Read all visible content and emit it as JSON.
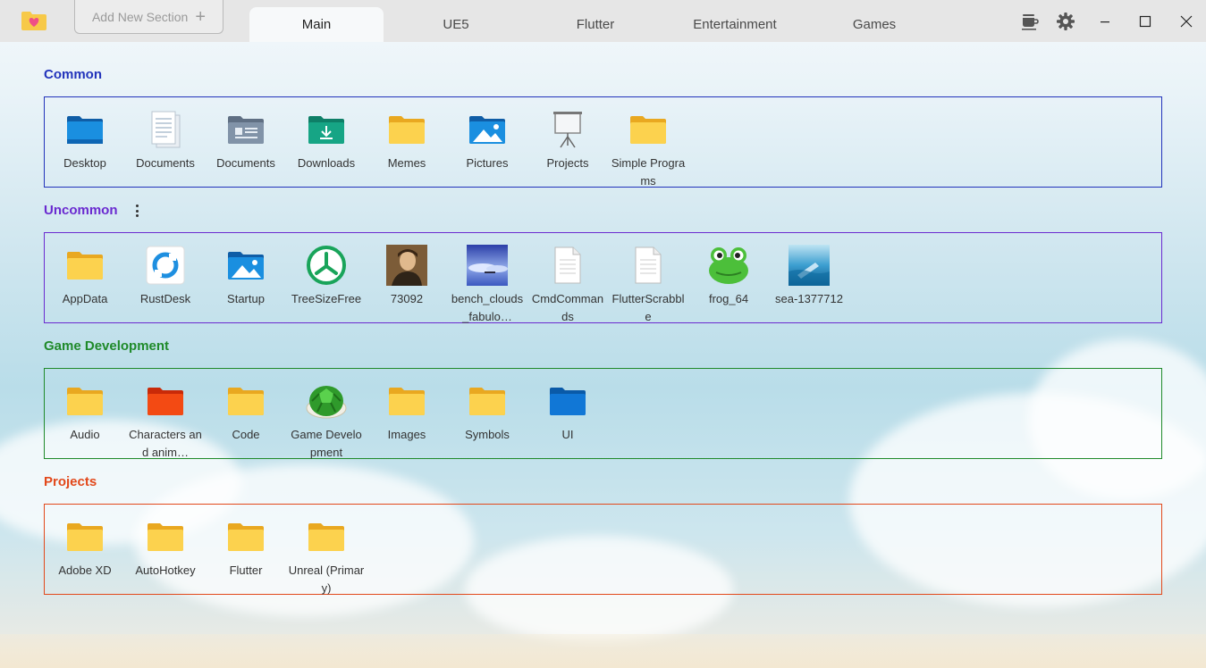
{
  "titlebar": {
    "add_section_label": "Add New Section",
    "tabs": [
      {
        "label": "Main",
        "active": true
      },
      {
        "label": "UE5",
        "active": false
      },
      {
        "label": "Flutter",
        "active": false
      },
      {
        "label": "Entertainment",
        "active": false
      },
      {
        "label": "Games",
        "active": false
      }
    ],
    "icons": [
      "coffee-icon",
      "gear-icon",
      "minimize-icon",
      "maximize-icon",
      "close-icon"
    ]
  },
  "sections": [
    {
      "title": "Common",
      "color": "#2233bb",
      "items": [
        {
          "label": "Desktop",
          "icon": "desktop-folder-icon"
        },
        {
          "label": "Documents",
          "icon": "document-file-icon"
        },
        {
          "label": "Documents",
          "icon": "documents-folder-icon"
        },
        {
          "label": "Downloads",
          "icon": "downloads-folder-icon"
        },
        {
          "label": "Memes",
          "icon": "folder-icon"
        },
        {
          "label": "Pictures",
          "icon": "pictures-folder-icon"
        },
        {
          "label": "Projects",
          "icon": "projector-icon"
        },
        {
          "label": "Simple Programs",
          "icon": "folder-icon"
        }
      ]
    },
    {
      "title": "Uncommon",
      "color": "#6a2ad0",
      "items": [
        {
          "label": "AppData",
          "icon": "folder-icon"
        },
        {
          "label": "RustDesk",
          "icon": "rustdesk-icon"
        },
        {
          "label": "Startup",
          "icon": "pictures-folder-icon"
        },
        {
          "label": "TreeSizeFree",
          "icon": "treesize-icon"
        },
        {
          "label": "73092",
          "icon": "portrait-image-icon"
        },
        {
          "label": "bench_clouds_fabulo…",
          "icon": "landscape-image-icon"
        },
        {
          "label": "CmdCommands",
          "icon": "text-file-icon"
        },
        {
          "label": "FlutterScrabble",
          "icon": "text-file-icon"
        },
        {
          "label": "frog_64",
          "icon": "frog-icon"
        },
        {
          "label": "sea-1377712",
          "icon": "sea-image-icon"
        }
      ]
    },
    {
      "title": "Game Development",
      "color": "#1f8a2a",
      "items": [
        {
          "label": "Audio",
          "icon": "folder-icon"
        },
        {
          "label": "Characters and anim…",
          "icon": "red-folder-icon"
        },
        {
          "label": "Code",
          "icon": "folder-icon"
        },
        {
          "label": "Game Development",
          "icon": "green-shell-icon"
        },
        {
          "label": "Images",
          "icon": "folder-icon"
        },
        {
          "label": "Symbols",
          "icon": "folder-icon"
        },
        {
          "label": "UI",
          "icon": "blue-folder-icon"
        }
      ]
    },
    {
      "title": "Projects",
      "color": "#e2481a",
      "items": [
        {
          "label": "Adobe XD",
          "icon": "folder-icon"
        },
        {
          "label": "AutoHotkey",
          "icon": "folder-icon"
        },
        {
          "label": "Flutter",
          "icon": "folder-icon"
        },
        {
          "label": "Unreal (Primary)",
          "icon": "folder-icon"
        }
      ]
    }
  ]
}
